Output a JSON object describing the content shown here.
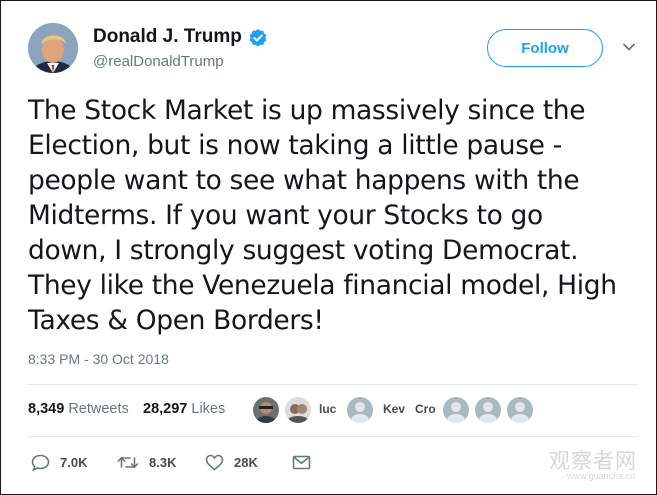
{
  "author": {
    "display_name": "Donald J. Trump",
    "handle": "@realDonaldTrump",
    "verified": true,
    "avatar_icon": "profile-photo"
  },
  "follow_button": {
    "label": "Follow"
  },
  "menu": {
    "icon": "chevron-down-icon"
  },
  "tweet": {
    "lines": [
      "The Stock Market is up massively since the",
      "Election, but is now taking a little pause -",
      "people want to see what happens with the",
      "Midterms. If you want your Stocks to go",
      "down, I strongly suggest voting Democrat.",
      "They like the Venezuela financial model, High",
      "Taxes & Open Borders!"
    ],
    "timestamp": "8:33 PM - 30 Oct 2018"
  },
  "stats": {
    "retweets_count": "8,349",
    "retweets_label": "Retweets",
    "likes_count": "28,297",
    "likes_label": "Likes"
  },
  "likers": [
    {
      "type": "photo",
      "name": ""
    },
    {
      "type": "photo",
      "name": "luc"
    },
    {
      "type": "default",
      "name": "Kev"
    },
    {
      "type": "default",
      "name": "Cro"
    },
    {
      "type": "default",
      "name": ""
    },
    {
      "type": "default",
      "name": ""
    },
    {
      "type": "default",
      "name": ""
    }
  ],
  "actions": {
    "reply_count": "7.0K",
    "retweet_count": "8.3K",
    "like_count": "28K"
  },
  "watermark": {
    "text": "观察者网",
    "url": "www.guancha.cn"
  },
  "colors": {
    "accent": "#1da1f2",
    "text": "#14171a",
    "muted": "#657786",
    "divider": "#e1e8ed"
  }
}
